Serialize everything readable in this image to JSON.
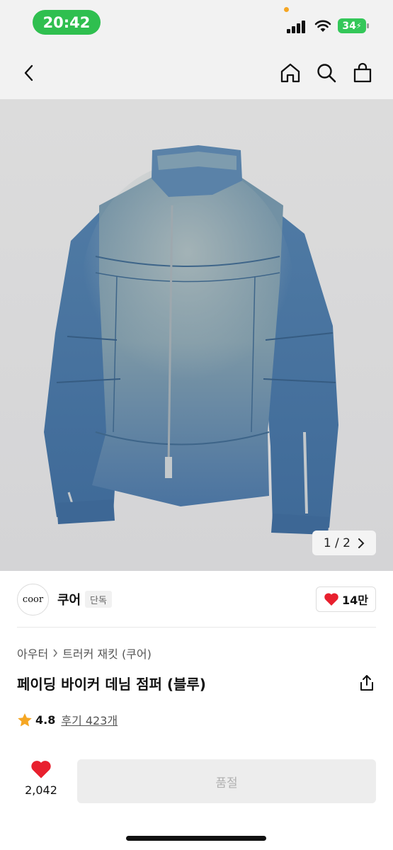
{
  "status_bar": {
    "time": "20:42",
    "battery": "34"
  },
  "nav": {
    "icons": [
      "back-icon",
      "home-icon",
      "search-icon",
      "shopping-bag-icon"
    ]
  },
  "gallery": {
    "indicator": "1 / 2"
  },
  "brand": {
    "logo_text": "coor",
    "name": "쿠어",
    "badge": "단독",
    "likes": "14만"
  },
  "product": {
    "breadcrumb": [
      "아우터",
      "트러커 재킷 (쿠어)"
    ],
    "title": "페이딩 바이커 데님 점퍼 (블루)",
    "rating": "4.8",
    "reviews": "후기 423개"
  },
  "bottom": {
    "wish_count": "2,042",
    "action_label": "품절"
  },
  "colors": {
    "accent_red": "#e8202e",
    "status_green": "#2fbf4f",
    "star": "#f5a623"
  }
}
